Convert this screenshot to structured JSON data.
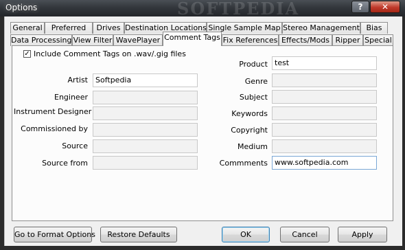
{
  "window": {
    "title": "Options",
    "help_label": "?",
    "close_label": "✕",
    "watermark": "SOFTPEDIA"
  },
  "tabs_row1": [
    "General",
    "Preferred",
    "Drives",
    "Destination Locations",
    "Single Sample Map",
    "Stereo Management",
    "Bias"
  ],
  "tabs_row2": [
    "Data Processing",
    "View Filter",
    "WavePlayer",
    "Comment Tags",
    "Fix References",
    "Effects/Mods",
    "Ripper",
    "Special"
  ],
  "active_tab": "Comment Tags",
  "include_checkbox": {
    "label": "Include Comment Tags on .wav/.gig files",
    "checked": true
  },
  "left_fields": [
    {
      "label": "Artist",
      "value": "Softpedia"
    },
    {
      "label": "Engineer",
      "value": ""
    },
    {
      "label": "Instrument Designer",
      "value": ""
    },
    {
      "label": "Commissioned by",
      "value": ""
    },
    {
      "label": "Source",
      "value": ""
    },
    {
      "label": "Source from",
      "value": ""
    }
  ],
  "right_fields": [
    {
      "label": "Product",
      "value": "test"
    },
    {
      "label": "Genre",
      "value": ""
    },
    {
      "label": "Subject",
      "value": ""
    },
    {
      "label": "Keywords",
      "value": ""
    },
    {
      "label": "Copyright",
      "value": ""
    },
    {
      "label": "Medium",
      "value": ""
    },
    {
      "label": "Commments",
      "value": "www.softpedia.com"
    }
  ],
  "buttons": {
    "format_options": "Go to Format Options",
    "restore_defaults": "Restore Defaults",
    "ok": "OK",
    "cancel": "Cancel",
    "apply": "Apply"
  }
}
